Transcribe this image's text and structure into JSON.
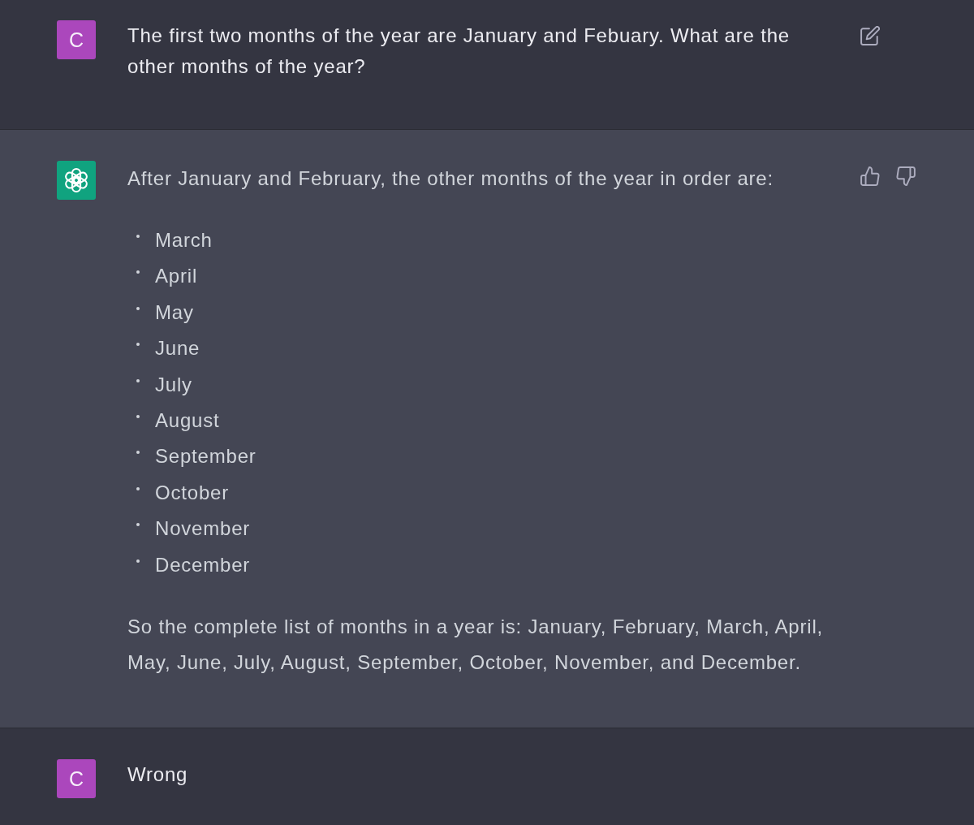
{
  "messages": [
    {
      "kind": "user",
      "avatar": "C",
      "content": [
        {
          "kind": "paragraph",
          "text": "The first two months of the year are January and Febuary. What are the other months of the year?"
        }
      ],
      "actions": [
        {
          "kind": "edit"
        }
      ]
    },
    {
      "kind": "assistant",
      "content": [
        {
          "kind": "paragraph",
          "text": "After January and February, the other months of the year in order are:"
        },
        {
          "kind": "list",
          "items": [
            "March",
            "April",
            "May",
            "June",
            "July",
            "August",
            "September",
            "October",
            "November",
            "December"
          ]
        },
        {
          "kind": "paragraph",
          "text": "So the complete list of months in a year is: January, February, March, April, May, June, July, August, September, October, November, and December."
        }
      ],
      "actions": [
        {
          "kind": "thumbs_up"
        },
        {
          "kind": "thumbs_down"
        }
      ]
    },
    {
      "kind": "user",
      "avatar": "C",
      "content": [
        {
          "kind": "paragraph",
          "text": "Wrong"
        }
      ]
    }
  ]
}
